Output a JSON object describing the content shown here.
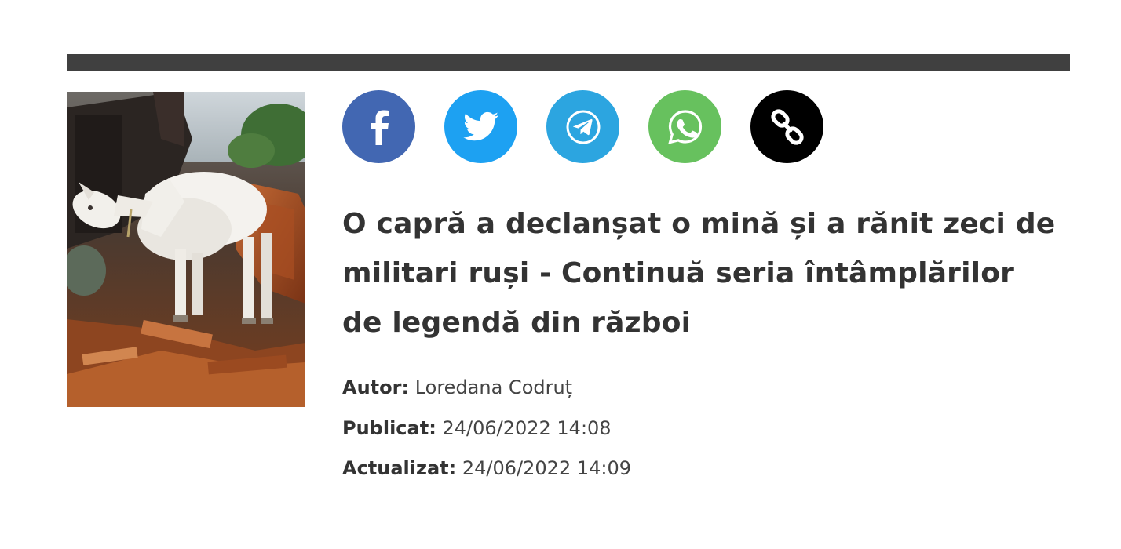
{
  "article": {
    "image_alt": "White goat standing on a rusty destroyed vehicle",
    "headline": "O capră a declanșat o mină și a rănit zeci de militari ruși - Continuă seria întâmplărilor de legendă din război",
    "author_label": "Autor:",
    "author_name": "Loredana Codruț",
    "published_label": "Publicat:",
    "published_value": "24/06/2022 14:08",
    "updated_label": "Actualizat:",
    "updated_value": "24/06/2022 14:09"
  },
  "share": [
    {
      "icon": "facebook-icon",
      "color": "#4267b2"
    },
    {
      "icon": "twitter-icon",
      "color": "#1da1f2"
    },
    {
      "icon": "telegram-icon",
      "color": "#2ca5e0"
    },
    {
      "icon": "whatsapp-icon",
      "color": "#67c15e"
    },
    {
      "icon": "link-icon",
      "color": "#000000"
    }
  ],
  "colors": {
    "divider": "#404040",
    "text": "#333333"
  }
}
